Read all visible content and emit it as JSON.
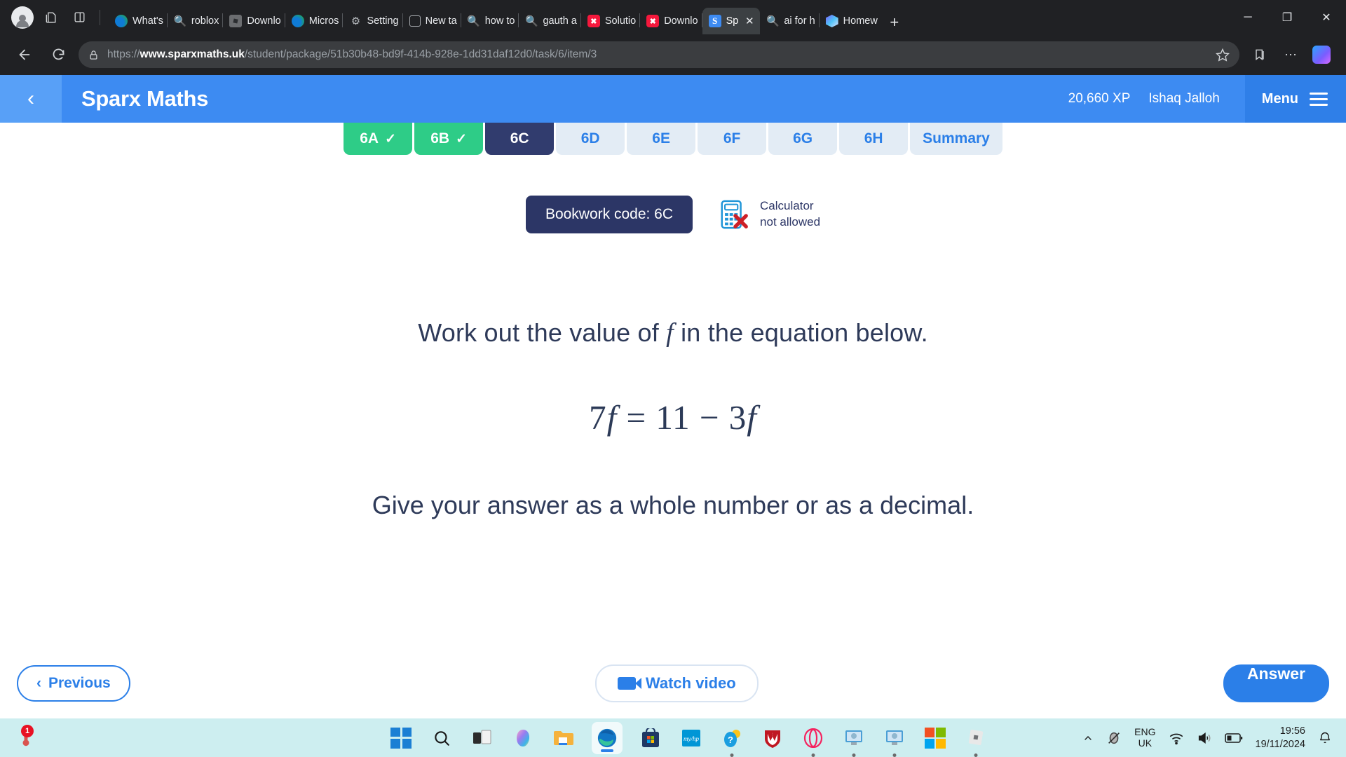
{
  "browser": {
    "tabs": [
      {
        "label": "What's",
        "icon": "edge-icon"
      },
      {
        "label": "roblox",
        "icon": "search-icon"
      },
      {
        "label": "Downlo",
        "icon": "roblox-icon"
      },
      {
        "label": "Micros",
        "icon": "edge-icon"
      },
      {
        "label": "Setting",
        "icon": "gear-icon"
      },
      {
        "label": "New ta",
        "icon": "news-icon"
      },
      {
        "label": "how to",
        "icon": "search-icon"
      },
      {
        "label": "gauth a",
        "icon": "search-icon"
      },
      {
        "label": "Solutio",
        "icon": "x-red-icon"
      },
      {
        "label": "Downlo",
        "icon": "x-red-icon"
      },
      {
        "label": "Sp",
        "icon": "sparx-icon",
        "active": true
      },
      {
        "label": "ai for h",
        "icon": "search-icon"
      },
      {
        "label": "Homew",
        "icon": "hex-icon"
      }
    ],
    "new_tab_label": "+",
    "url": {
      "scheme": "https://",
      "domain": "www.sparxmaths.uk",
      "path": "/student/package/51b30b48-bd9f-414b-928e-1dd31daf12d0/task/6/item/3"
    },
    "window_controls": {
      "minimize": "─",
      "maximize": "❐",
      "close": "✕"
    }
  },
  "sparx": {
    "back_label": "‹",
    "brand": "Sparx Maths",
    "xp": "20,660 XP",
    "username": "Ishaq Jalloh",
    "menu_label": "Menu",
    "task_tabs": [
      {
        "label": "6A",
        "state": "done",
        "tick": "✓"
      },
      {
        "label": "6B",
        "state": "done",
        "tick": "✓"
      },
      {
        "label": "6C",
        "state": "active"
      },
      {
        "label": "6D",
        "state": "todo"
      },
      {
        "label": "6E",
        "state": "todo"
      },
      {
        "label": "6F",
        "state": "todo"
      },
      {
        "label": "6G",
        "state": "todo"
      },
      {
        "label": "6H",
        "state": "todo"
      },
      {
        "label": "Summary",
        "state": "todo"
      }
    ],
    "bookwork_code": "Bookwork code: 6C",
    "calculator_line1": "Calculator",
    "calculator_line2": "not allowed",
    "question": {
      "prompt_before": "Work out the value of",
      "prompt_variable": "f",
      "prompt_after": "in the equation below.",
      "equation_lhs_coef": "7",
      "equation_lhs_var": "f",
      "equation_equals": "=",
      "equation_rhs_const": "11",
      "equation_minus": "−",
      "equation_rhs_coef": "3",
      "equation_rhs_var": "f",
      "instruction": "Give your answer as a whole number or as a decimal."
    },
    "previous_label": "Previous",
    "previous_chevron": "‹",
    "watch_video_label": "Watch video",
    "answer_label": "Answer",
    "colors": {
      "header_blue": "#3d8bf2",
      "active_tab_navy": "#313c6e",
      "done_green": "#2ecc87",
      "accent_blue": "#2b7fe8",
      "bookwork_navy": "#2c3666"
    }
  },
  "taskbar": {
    "badge_count": "1",
    "apps": [
      {
        "name": "start-button"
      },
      {
        "name": "search-taskbar-icon"
      },
      {
        "name": "task-view-icon"
      },
      {
        "name": "copilot-icon"
      },
      {
        "name": "file-explorer-icon"
      },
      {
        "name": "edge-icon"
      },
      {
        "name": "microsoft-store-icon"
      },
      {
        "name": "myhp-icon"
      },
      {
        "name": "help-icon"
      },
      {
        "name": "mcafee-icon"
      },
      {
        "name": "opera-icon"
      },
      {
        "name": "remote-desktop-icon"
      },
      {
        "name": "remote-desktop-2-icon"
      },
      {
        "name": "microsoft-office-icon"
      },
      {
        "name": "roblox-icon"
      }
    ],
    "tray": {
      "chevron": "˄",
      "language_line1": "ENG",
      "language_line2": "UK",
      "time": "19:56",
      "date": "19/11/2024"
    }
  }
}
